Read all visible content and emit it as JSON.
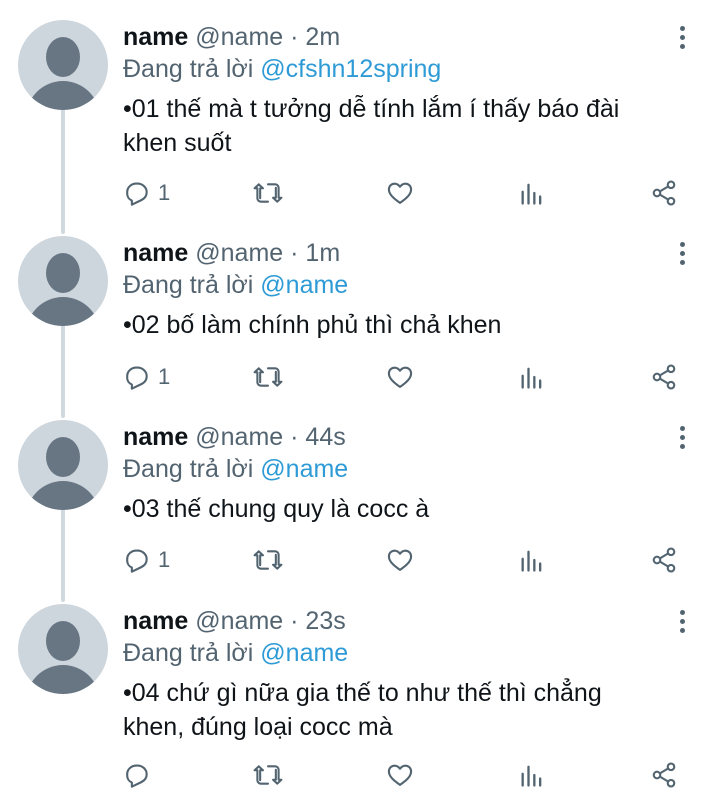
{
  "tweets": [
    {
      "display_name": "name",
      "handle": "@name",
      "separator": "·",
      "time": "2m",
      "reply_prefix": "Đang trả lời",
      "reply_to": "@cfshn12spring",
      "text_lines": [
        "•01 thế mà t tưởng dễ tính lắm í thấy báo đài",
        "khen suốt"
      ],
      "reply_count": "1"
    },
    {
      "display_name": "name",
      "handle": "@name",
      "separator": "·",
      "time": "1m",
      "reply_prefix": "Đang trả lời",
      "reply_to": "@name",
      "text_lines": [
        "•02 bố làm chính phủ thì chả khen"
      ],
      "reply_count": "1"
    },
    {
      "display_name": "name",
      "handle": "@name",
      "separator": "·",
      "time": "44s",
      "reply_prefix": "Đang trả lời",
      "reply_to": "@name",
      "text_lines": [
        "•03 thế chung quy là cocc à"
      ],
      "reply_count": "1"
    },
    {
      "display_name": "name",
      "handle": "@name",
      "separator": "·",
      "time": "23s",
      "reply_prefix": "Đang trả lời",
      "reply_to": "@name",
      "text_lines": [
        "•04 chứ gì nữa gia thế to như thế thì chẳng",
        "khen, đúng loại cocc mà"
      ],
      "reply_count": ""
    }
  ],
  "icons": {
    "reply": "reply-icon",
    "retweet": "retweet-icon",
    "like": "heart-icon",
    "views": "views-icon",
    "share": "share-icon",
    "more": "more-vertical-icon"
  },
  "colors": {
    "text": "#0f1419",
    "muted": "#536471",
    "mention": "#2f9bd6",
    "thread_line": "#cfd9de",
    "avatar_bg": "#cdd6dd",
    "avatar_fg": "#687684"
  }
}
